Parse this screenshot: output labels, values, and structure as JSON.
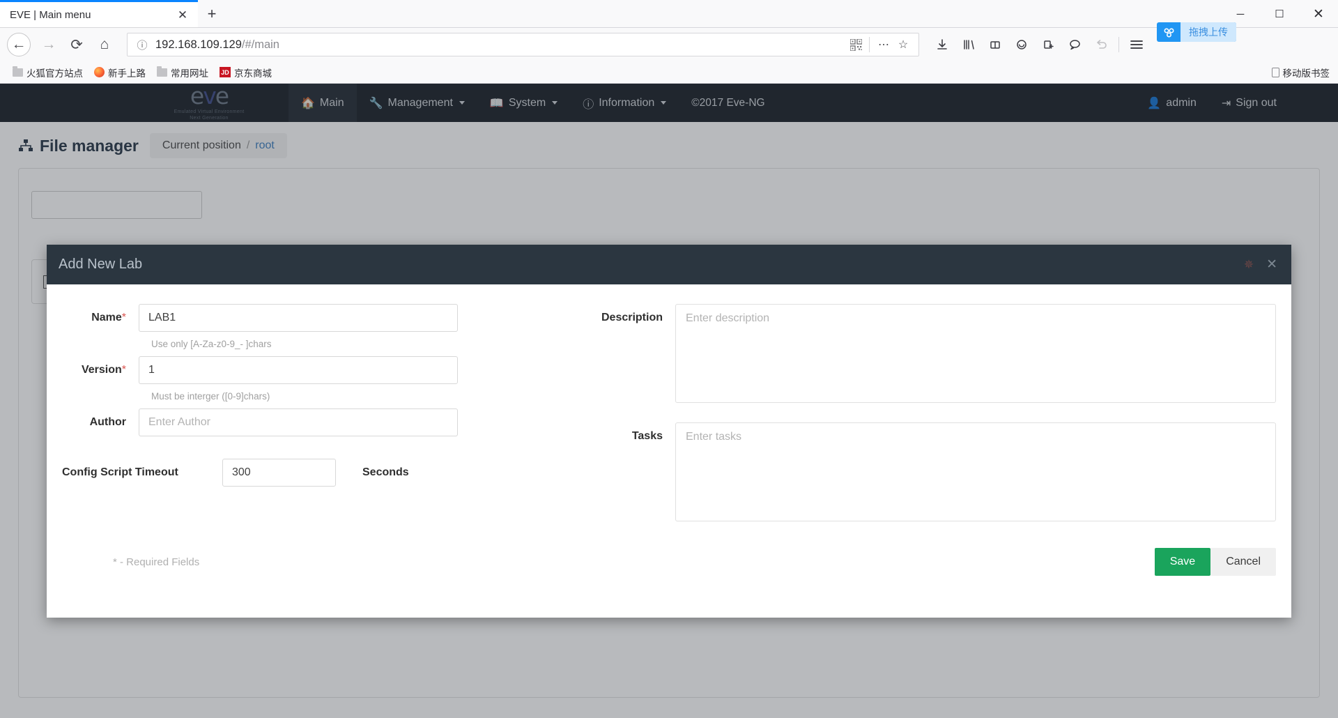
{
  "browser": {
    "tab": {
      "title": "EVE | Main menu",
      "close_icon": "close-icon"
    },
    "new_tab_label": "+",
    "window_controls": {
      "minimize": "—",
      "maximize": "☐",
      "close": "✕"
    },
    "url": {
      "host": "192.168.109.129",
      "path": "/#/main",
      "info_icon": "info-icon"
    },
    "toolbar_icons": [
      "download-icon",
      "library-icon",
      "pocket-icon",
      "account-icon",
      "save-to-pocket-icon",
      "chat-icon",
      "undo-icon",
      "hamburger-menu-icon"
    ],
    "upload_badge": {
      "label": "拖拽上传",
      "icon": "baidu-netdisk-icon",
      "color": "#2196f3"
    },
    "bookmarks": [
      {
        "label": "火狐官方站点",
        "icon": "folder-icon"
      },
      {
        "label": "新手上路",
        "icon": "firefox-icon"
      },
      {
        "label": "常用网址",
        "icon": "folder-icon"
      },
      {
        "label": "京东商城",
        "icon": "jd-icon",
        "icon_text": "JD"
      }
    ],
    "bookmarks_right": {
      "label": "移动版书签",
      "icon": "mobile-bookmarks-icon"
    }
  },
  "eve": {
    "logo": {
      "text_left": "e",
      "text_mid": "v",
      "text_right": "e",
      "subtitle_line1": "Emulated Virtual Environment",
      "subtitle_line2": "Next Generation"
    },
    "menu": [
      {
        "label": "Main",
        "icon": "home-icon",
        "caret": false,
        "active": true
      },
      {
        "label": "Management",
        "icon": "wrench-icon",
        "caret": true,
        "active": false
      },
      {
        "label": "System",
        "icon": "book-icon",
        "caret": true,
        "active": false
      },
      {
        "label": "Information",
        "icon": "info-circle-icon",
        "caret": true,
        "active": false
      }
    ],
    "copyright": "©2017 Eve-NG",
    "user": {
      "label": "admin",
      "icon": "user-icon"
    },
    "signout": {
      "label": "Sign out",
      "icon": "signout-icon"
    }
  },
  "filemanager": {
    "title": "File manager",
    "title_icon": "sitemap-icon",
    "breadcrumb": {
      "current_label": "Current position",
      "separator": "/",
      "path": "root"
    }
  },
  "modal": {
    "title": "Add New Lab",
    "spinner_icon": "spinner-icon",
    "close_icon": "close-icon",
    "fields": {
      "name": {
        "label": "Name",
        "required": "*",
        "value": "LAB1",
        "hint": "Use only [A-Za-z0-9_- ]chars"
      },
      "version": {
        "label": "Version",
        "required": "*",
        "value": "1",
        "hint": "Must be interger ([0-9]chars)"
      },
      "author": {
        "label": "Author",
        "value": "",
        "placeholder": "Enter Author"
      },
      "timeout": {
        "label": "Config Script Timeout",
        "value": "300",
        "unit": "Seconds"
      },
      "description": {
        "label": "Description",
        "value": "",
        "placeholder": "Enter description"
      },
      "tasks": {
        "label": "Tasks",
        "value": "",
        "placeholder": "Enter tasks"
      }
    },
    "required_note": "* - Required Fields",
    "buttons": {
      "save": "Save",
      "cancel": "Cancel"
    },
    "colors": {
      "save_bg": "#1aa45c",
      "header_bg": "#2b3640"
    }
  }
}
